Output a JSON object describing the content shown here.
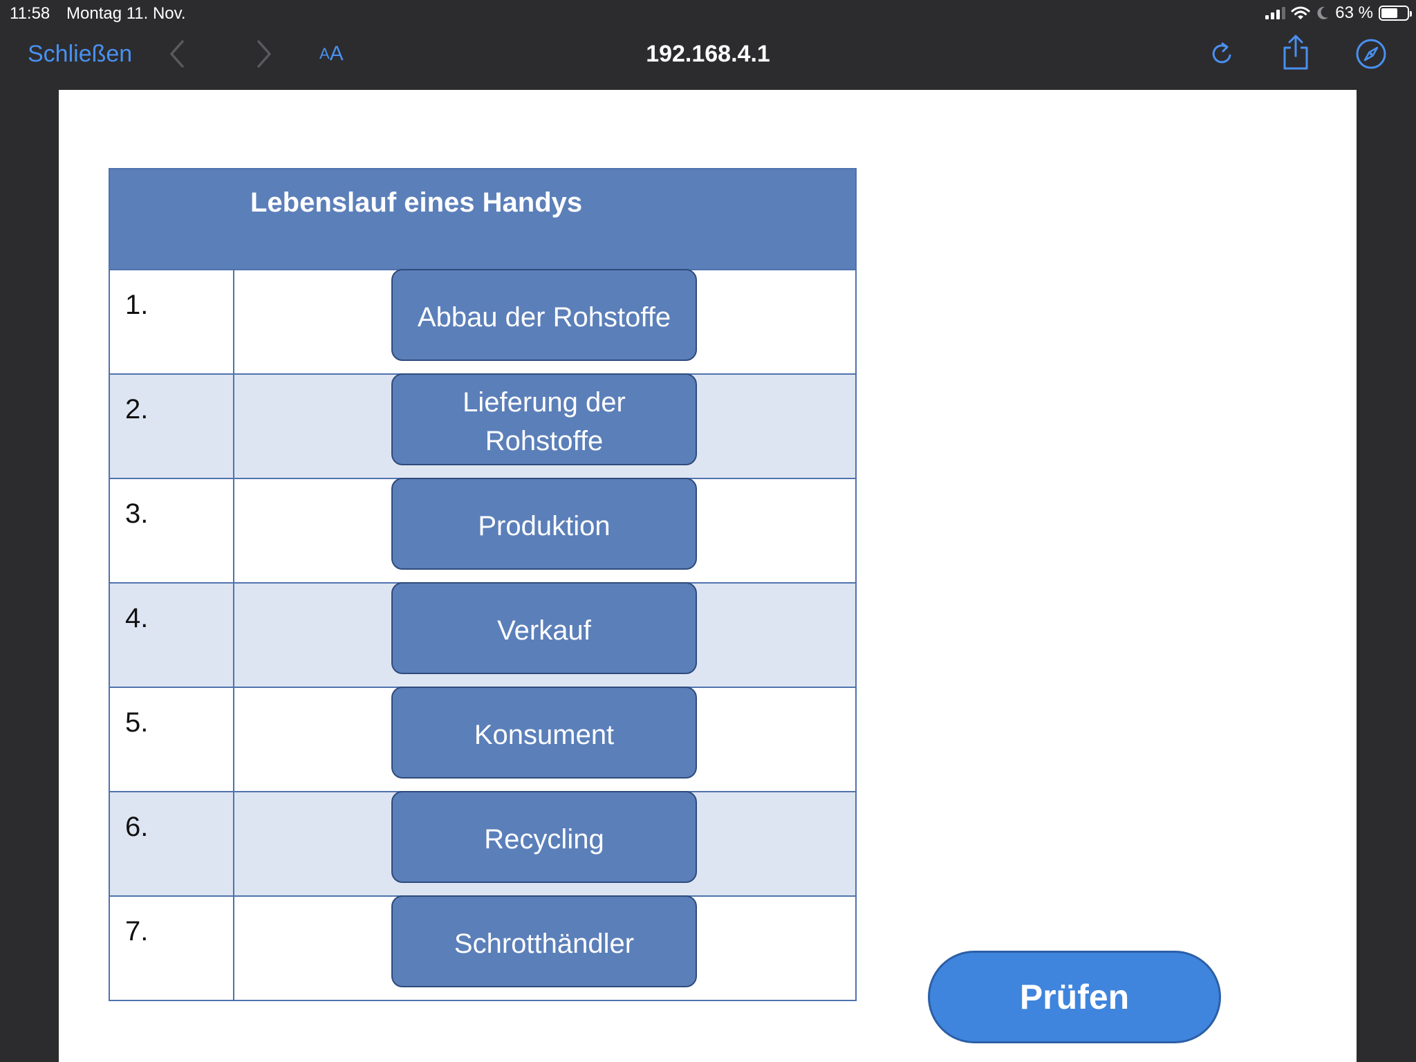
{
  "status_bar": {
    "time": "11:58",
    "date": "Montag 11. Nov.",
    "battery": "63 %",
    "battery_level": 0.63
  },
  "toolbar": {
    "close_label": "Schließen",
    "text_size_small": "A",
    "text_size_large": "A",
    "url": "192.168.4.1",
    "accent_color": "#4a90f0"
  },
  "table": {
    "title": "Lebenslauf eines Handys",
    "rows": [
      {
        "number": "1.",
        "card": "Abbau der Rohstoffe"
      },
      {
        "number": "2.",
        "card": "Lieferung der Rohstoffe"
      },
      {
        "number": "3.",
        "card": "Produktion"
      },
      {
        "number": "4.",
        "card": "Verkauf"
      },
      {
        "number": "5.",
        "card": "Konsument"
      },
      {
        "number": "6.",
        "card": "Recycling"
      },
      {
        "number": "7.",
        "card": "Schrotthändler"
      }
    ],
    "header_color": "#5b7fb9",
    "alt_row_color": "#dee5f2"
  },
  "check_button": {
    "label": "Prüfen",
    "color": "#3f85dd"
  }
}
